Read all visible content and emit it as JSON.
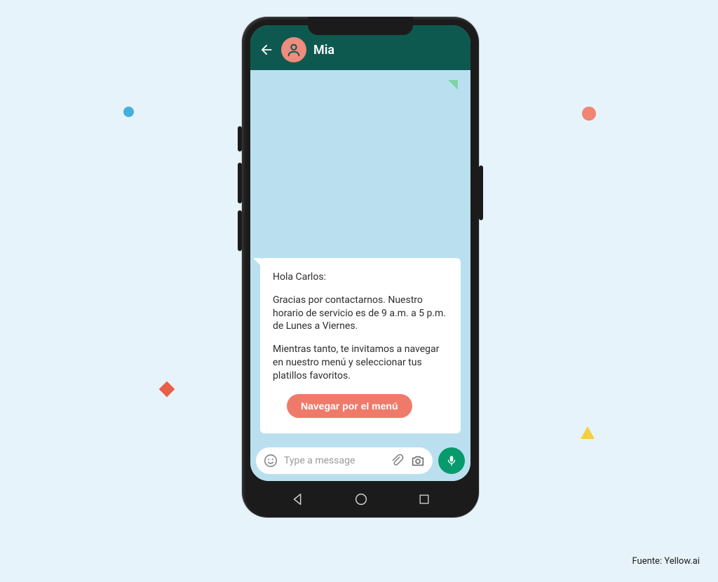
{
  "chat": {
    "contact_name": "Mia",
    "message": {
      "greeting": "Hola Carlos:",
      "body1": "Gracias por contactarnos. Nuestro horario de servicio es de 9 a.m. a 5 p.m. de Lunes a Viernes.",
      "body2": "Mientras tanto, te invitamos a navegar en nuestro menú y seleccionar tus platillos favoritos.",
      "button_label": "Navegar por el menú"
    },
    "input_placeholder": "Type a message"
  },
  "attribution": "Fuente: Yellow.ai"
}
